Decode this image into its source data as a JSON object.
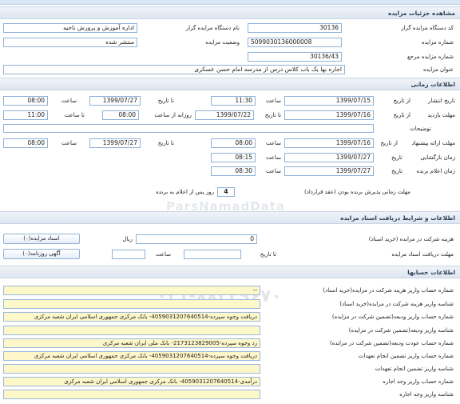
{
  "sections": {
    "details": "مشاهده جزئیات مزایده",
    "timing": "اطلاعات زمانی",
    "conditions": "اطلاعات و شرایط دریافت اسناد مزایده",
    "accounts": "اطلاعات حسابها"
  },
  "details": {
    "org_code_label": "کد دستگاه مزایده گزار",
    "org_code": "30136",
    "org_name_label": "نام دستگاه مزایده گزار",
    "org_name": "اداره آموزش و پرورش ناحیه",
    "auction_no_label": "شماره مزایده",
    "auction_no": "5099030136000008",
    "status_label": "وضعیت مزایده",
    "status": "منتشر شده",
    "ref_no_label": "شماره مزایده مرجع",
    "ref_no": "30136/43",
    "title_label": "عنوان مزایده",
    "title": "اجاره بها یک باب کلاس درس از مدرسه امام حسن عسکری"
  },
  "timing": {
    "from_date": "از تاریخ",
    "to_date": "تا تاریخ",
    "time": "ساعت",
    "to_time": "تا ساعت",
    "daily_from_time": "روزانه از ساعت",
    "date": "تاریخ",
    "publish_label": "تاریخ انتشار",
    "publish_from_date": "1399/07/15",
    "publish_from_time": "11:30",
    "publish_to_date": "1399/07/27",
    "publish_to_time": "08:00",
    "visit_label": "مهلت بازدید",
    "visit_from_date": "1399/07/16",
    "visit_to_date": "1399/07/22",
    "visit_daily_from": "08:00",
    "visit_to_time": "11:00",
    "desc_label": "توضیحات",
    "desc": "",
    "offer_label": "مهلت ارائه پیشنهاد",
    "offer_from_date": "1399/07/16",
    "offer_from_time": "08:00",
    "offer_to_date": "1399/07/27",
    "offer_to_time": "08:00",
    "opening_label": "زمان بازگشایی",
    "opening_date": "1399/07/27",
    "opening_time": "08:15",
    "winner_label": "زمان اعلام برنده",
    "winner_date": "1399/07/27",
    "winner_time": "08:30",
    "validity_label": "مهلت زمانی پذیرش برنده بودن (عقد قرارداد)",
    "validity_value": "4",
    "validity_suffix": "روز پس از اعلام به برنده"
  },
  "conditions": {
    "fee_label": "هزینه شرکت در مزایده (خرید اسناد)",
    "fee_value": "0",
    "fee_unit": "ریال",
    "receive_label": "مهلت دریافت اسناد مزایده",
    "receive_to_date": "تا تاریخ",
    "receive_time": "ساعت",
    "receive_date_value": "",
    "receive_time_value": "",
    "docs_button": "اسناد مزایده(۰)",
    "ads_button": "آگهی روزنامه(۰)"
  },
  "accounts": [
    {
      "label": "شماره حساب واریز هزینه شرکت در مزایده(خرید اسناد)",
      "value": "--"
    },
    {
      "label": "شناسه واریز هزینه شرکت در مزایده(خرید اسناد)",
      "value": ""
    },
    {
      "label": "شماره حساب واریز ودیعه(تضمین شرکت در مزایده)",
      "value": "دریافت وجوه سپرده-4059031207640514- بانک مرکزی جمهوری اسلامی ایران شعبه مرکزی"
    },
    {
      "label": "شناسه واریز ودیعه(تضمین شرکت در مزایده)",
      "value": ""
    },
    {
      "label": "شماره حساب عودت ودیعه(تضمین شرکت در مزایده)",
      "value": "رد وجوه سپرده-2173123829005- بانک ملی ایران شعبه مرکزی"
    },
    {
      "label": "شماره حساب واریز تضمین انجام تعهدات",
      "value": "دریافت وجوه سپرده-4059031207640514- بانک مرکزی جمهوری اسلامی ایران شعبه مرکزی"
    },
    {
      "label": "شناسه واریز تضمین انجام تعهدات",
      "value": ""
    },
    {
      "label": "شماره حساب واریز وجه اجاره",
      "value": "درآمدی-4059031207640514- بانک مرکزی جمهوری اسلامی ایران شعبه مرکزی"
    },
    {
      "label": "شناسه واریز وجه اجاره",
      "value": ""
    }
  ],
  "watermark": {
    "brand": "ParsNamadData",
    "phone": "۰۲۱-۸۸۳۴۹۶۷۰"
  },
  "colors": {
    "border": "#8fb2d8",
    "section_bg": "#e4ecf4",
    "highlight": "#fdf7c9"
  }
}
